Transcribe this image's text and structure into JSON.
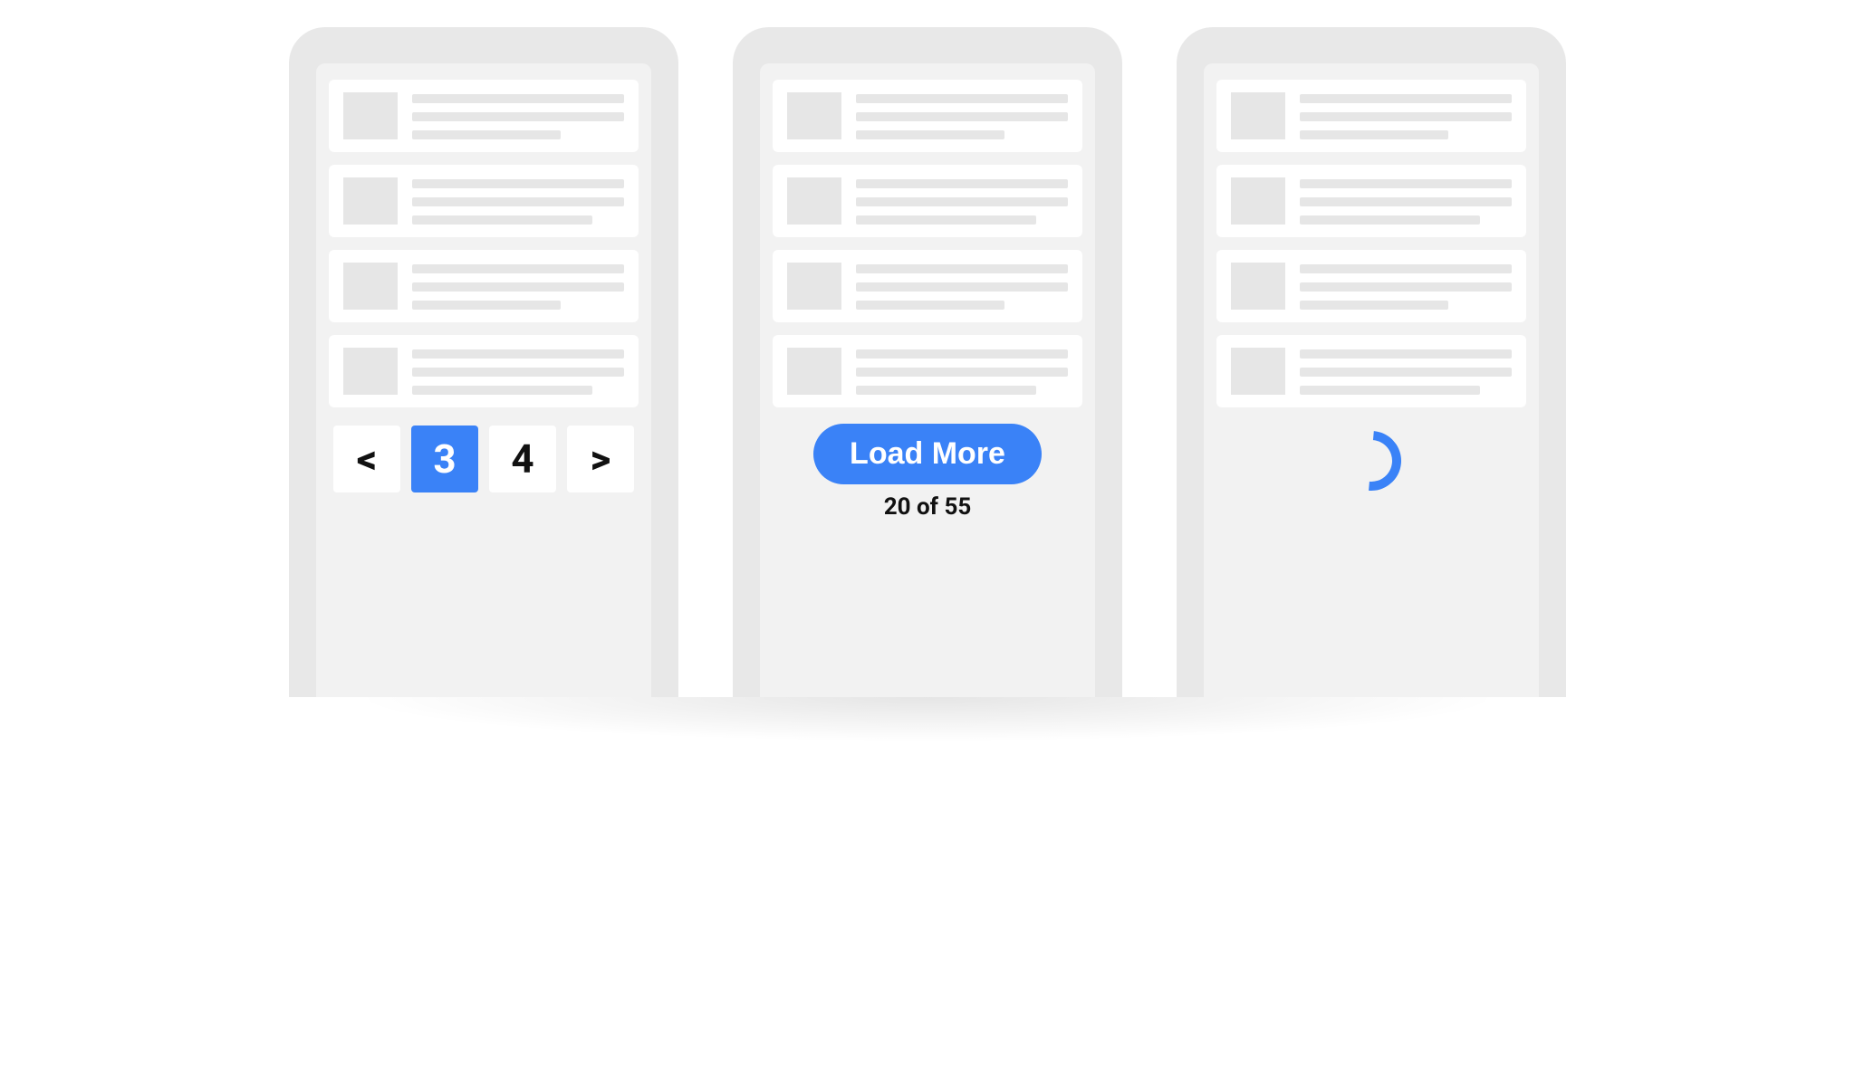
{
  "colors": {
    "accent": "#3a82f7",
    "device_bg": "#e8e8e8",
    "screen_bg": "#f2f2f2",
    "placeholder": "#e6e6e6"
  },
  "devices": [
    {
      "pattern": "pagination",
      "cards": 4,
      "pager": {
        "prev_glyph": "<",
        "next_glyph": ">",
        "pages": [
          {
            "label": "3",
            "active": true
          },
          {
            "label": "4",
            "active": false
          }
        ]
      }
    },
    {
      "pattern": "load-more",
      "cards": 4,
      "load_more": {
        "button_label": "Load More",
        "count_label": "20 of 55",
        "loaded": 20,
        "total": 55
      }
    },
    {
      "pattern": "infinite-scroll",
      "cards": 4,
      "spinner": {
        "label": "loading"
      }
    }
  ]
}
